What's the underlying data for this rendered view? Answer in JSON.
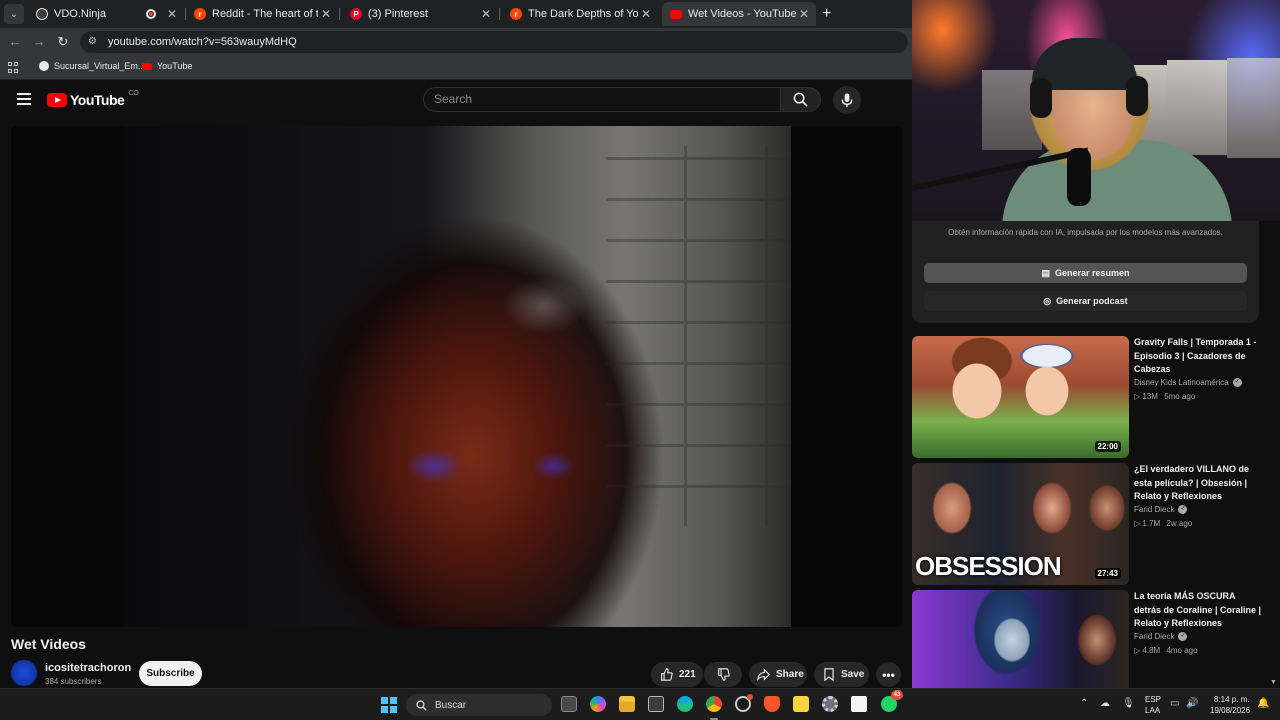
{
  "browser": {
    "tabs": [
      {
        "title": "VDO.Ninja",
        "active": false
      },
      {
        "title": "Reddit - The heart of the interne",
        "active": false
      },
      {
        "title": "(3) Pinterest",
        "active": false
      },
      {
        "title": "The Dark Depths of YouTube",
        "active": false
      },
      {
        "title": "Wet Videos - YouTube",
        "active": true
      }
    ],
    "url": "youtube.com/watch?v=563wauyMdHQ",
    "bookmarks": [
      "Sucursal_Virtual_Em...",
      "YouTube"
    ]
  },
  "youtube": {
    "logo_text": "YouTube",
    "country_code": "CO",
    "search_placeholder": "Search",
    "video": {
      "title": "Wet Videos",
      "channel": "icositetrachoron",
      "subscribers": "384 subscribers",
      "subscribe_label": "Subscribe",
      "likes": "221",
      "share_label": "Share",
      "save_label": "Save"
    },
    "ai_panel": {
      "info": "Obtén información rápida con IA, impulsada por los modelos más avanzados.",
      "summary_label": "Generar resumen",
      "podcast_label": "Generar podcast"
    },
    "recommendations": [
      {
        "title": "Gravity Falls | Temporada 1 - Episodio 3 | Cazadores de Cabezas",
        "channel": "Disney Kids Latinoamérica",
        "views": "13M",
        "age": "5mo ago",
        "duration": "22:00"
      },
      {
        "title": "¿El verdadero VILLANO de esta película? | Obsesión | Relato y Reflexiones",
        "channel": "Farid Dieck",
        "views": "1.7M",
        "age": "2w ago",
        "duration": "27:43",
        "thumb_text": "OBSESSION"
      },
      {
        "title": "La teoría MÁS OSCURA detrás de Coraline | Coraline | Relato y Reflexiones",
        "channel": "Farid Dieck",
        "views": "4.8M",
        "age": "4mo ago",
        "duration": ""
      }
    ]
  },
  "taskbar": {
    "search_placeholder": "Buscar",
    "whatsapp_badge": "43",
    "language": "ESP",
    "layout": "LAA",
    "time": "8:14 p. m.",
    "date": "19/08/2026"
  },
  "colors": {
    "youtube_red": "#ff0000",
    "background": "#0f0f0f",
    "windows_accent": "#4cc2ff"
  }
}
